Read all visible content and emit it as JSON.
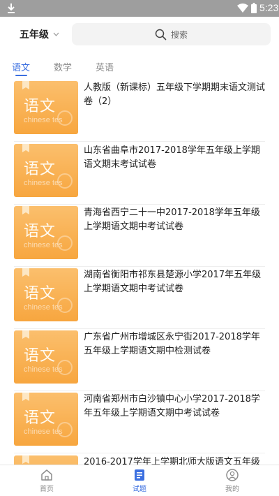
{
  "status_bar": {
    "time": "5:23"
  },
  "header": {
    "grade_selector": "五年级",
    "search_placeholder": "搜索"
  },
  "tabs": [
    {
      "label": "语文",
      "active": true
    },
    {
      "label": "数学",
      "active": false
    },
    {
      "label": "英语",
      "active": false
    }
  ],
  "thumbnail": {
    "main_text": "语文",
    "sub_text": "chinese tes"
  },
  "papers": [
    {
      "title": "人教版（新课标）五年级下学期期末语文测试卷（2）"
    },
    {
      "title": "山东省曲阜市2017-2018学年五年级上学期语文期末考试试卷"
    },
    {
      "title": "青海省西宁二十一中2017-2018学年五年级上学期语文期中考试试卷"
    },
    {
      "title": "湖南省衡阳市祁东县楚源小学2017年五年级上学期语文期中考试试卷"
    },
    {
      "title": "广东省广州市增城区永宁街2017-2018学年五年级上学期语文期中检测试卷"
    },
    {
      "title": "河南省郑州市白沙镇中心小学2017-2018学年五年级上学期语文期中考试试卷"
    },
    {
      "title": "2016-2017学年上学期北师大版语文五年级"
    }
  ],
  "bottom_nav": [
    {
      "label": "首页",
      "icon": "home-icon",
      "active": false
    },
    {
      "label": "试题",
      "icon": "document-icon",
      "active": true
    },
    {
      "label": "我的",
      "icon": "profile-icon",
      "active": false
    }
  ],
  "colors": {
    "accent": "#3b6fe0",
    "thumbnail": "#f7a63f",
    "status_bar": "#9e9e9e"
  }
}
